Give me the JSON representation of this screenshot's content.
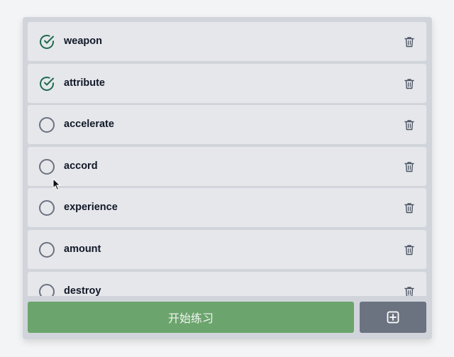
{
  "words": [
    {
      "text": "weapon",
      "done": true
    },
    {
      "text": "attribute",
      "done": true
    },
    {
      "text": "accelerate",
      "done": false
    },
    {
      "text": "accord",
      "done": false
    },
    {
      "text": "experience",
      "done": false
    },
    {
      "text": "amount",
      "done": false
    },
    {
      "text": "destroy",
      "done": false
    }
  ],
  "footer": {
    "start_label": "开始练习",
    "add_icon": "plus-square-icon"
  },
  "icons": {
    "done": "check-circle-icon",
    "pending": "empty-circle-icon",
    "delete": "trash-icon"
  },
  "colors": {
    "done_check": "#1f6b4d",
    "pending_circle": "#6b7280",
    "start_button": "#6ba46c",
    "add_button": "#6b7280",
    "row_background": "#e5e7eb",
    "panel_background": "#d1d5db"
  }
}
